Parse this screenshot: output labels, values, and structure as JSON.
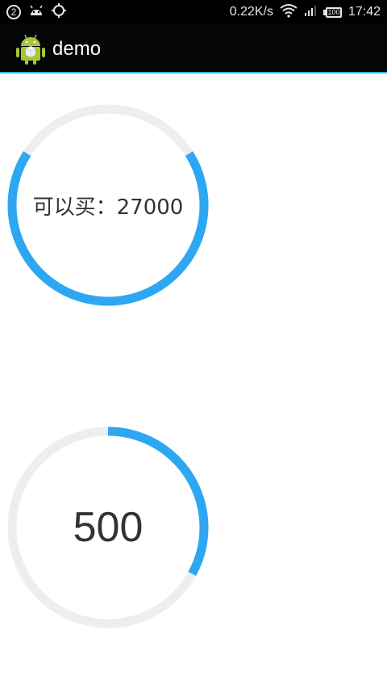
{
  "status_bar": {
    "notification_count": "2",
    "network_speed": "0.22K/s",
    "battery_level": "100",
    "time": "17:42",
    "icons": [
      "android-notification-icon",
      "sync-icon",
      "wifi-icon",
      "signal-icon",
      "battery-icon"
    ]
  },
  "app_bar": {
    "title": "demo",
    "icon": "android-robot-icon",
    "accent_color": "#33b5e5"
  },
  "gauges": [
    {
      "label": "可以买：27000",
      "progress_color": "#2ea7f2",
      "track_color": "#eeeeee",
      "progress_fraction": 0.68,
      "progress_start_fraction": 0.16
    },
    {
      "label": "500",
      "progress_color": "#2ea7f2",
      "track_color": "#eeeeee",
      "progress_fraction": 0.33,
      "progress_start_fraction": 0.0
    }
  ]
}
